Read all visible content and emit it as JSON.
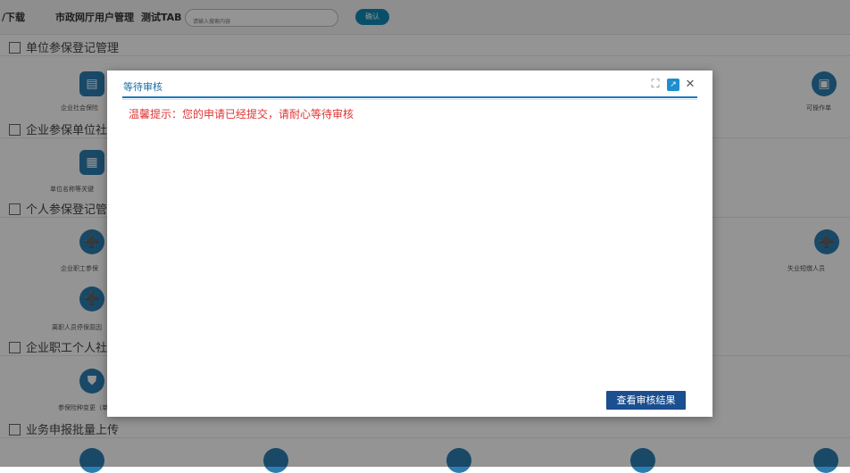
{
  "nav": {
    "items": [
      "/下载",
      "市政网厅用户管理",
      "测试TAB"
    ],
    "search_placeholder": "请输入搜索内容",
    "confirm_label": "确认"
  },
  "sections": [
    {
      "title": "单位参保登记管理"
    },
    {
      "title": "企业参保单位社会"
    },
    {
      "title": "个人参保登记管理"
    },
    {
      "title": "企业职工个人社会"
    },
    {
      "title": "业务申报批量上传"
    }
  ],
  "tiles": {
    "t1": "企业社会保险",
    "t2": "可操作单",
    "t3": "单位名称等关键",
    "t4": "企业职工参保",
    "t5": "失业短缴人员",
    "t6": "离职人员停保原因",
    "t7": "参保险种变更（单"
  },
  "modal": {
    "title": "等待审核",
    "notice": "温馨提示：您的申请已经提交，请耐心等待审核",
    "result_button": "查看审核结果"
  }
}
